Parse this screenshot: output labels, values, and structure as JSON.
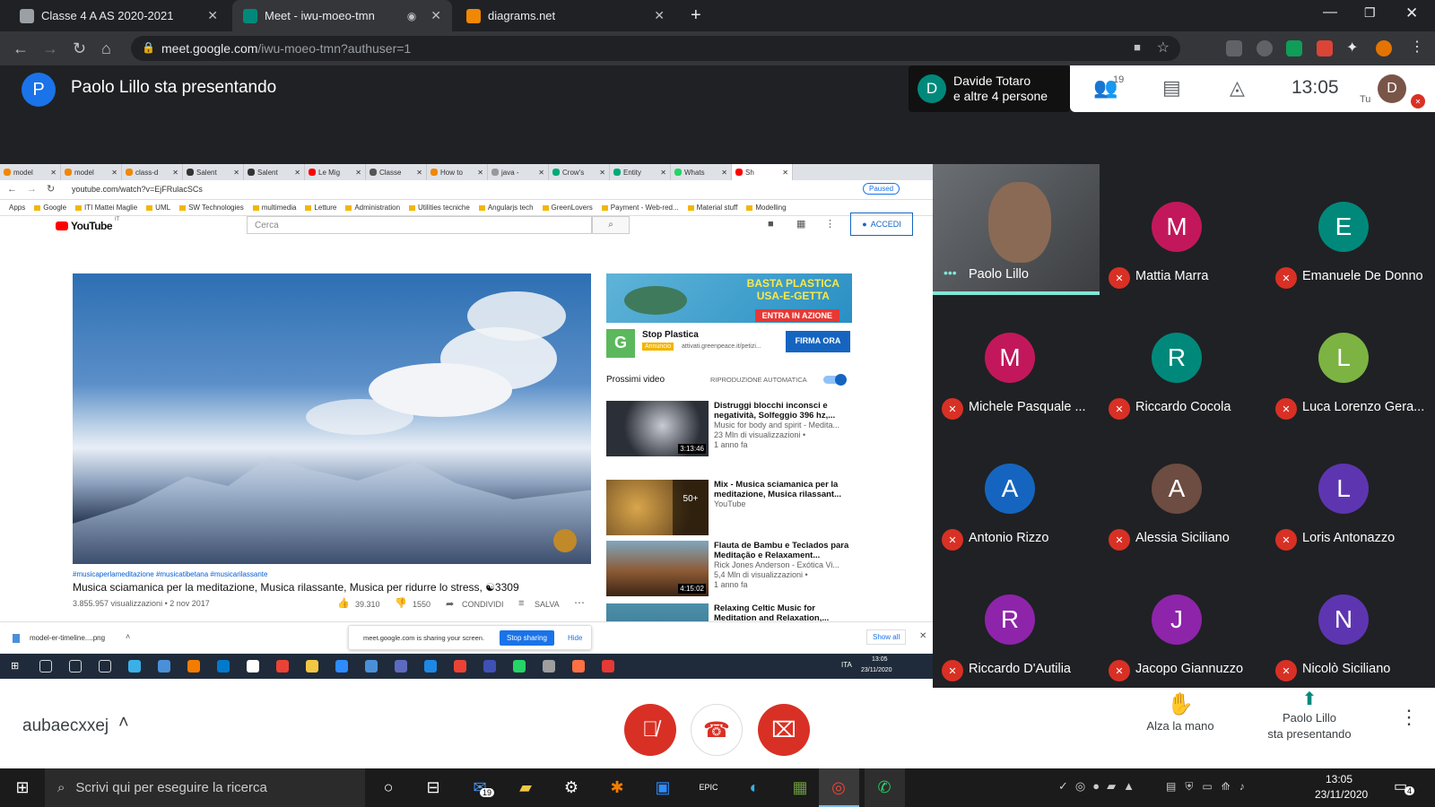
{
  "browser": {
    "tabs": [
      {
        "title": "Classe 4 A AS 2020-2021",
        "icon": "classroom-icon",
        "color": "#e8eaed"
      },
      {
        "title": "Meet - iwu-moeo-tmn",
        "icon": "meet-icon",
        "color": "#00897b",
        "active": true
      },
      {
        "title": "diagrams.net",
        "icon": "drawio-icon",
        "color": "#f08705"
      }
    ],
    "url_host": "meet.google.com",
    "url_path": "/iwu-moeo-tmn?authuser=1"
  },
  "meet": {
    "presenter_initial": "P",
    "presenter_title": "Paolo Lillo sta presentando",
    "pinned_initial": "D",
    "pinned_line1": "Davide Totaro",
    "pinned_line2": "e altre 4 persone",
    "participants_count": "19",
    "time": "13:05",
    "self_label": "Tu",
    "self_initial": "D",
    "meeting_code": "aubaecxxej",
    "raise_hand": "Alza la mano",
    "presenting_line1": "Paolo Lillo",
    "presenting_line2": "sta presentando"
  },
  "participants": [
    {
      "name": "Paolo Lillo",
      "initial": "",
      "color": "#444",
      "video": true
    },
    {
      "name": "Mattia Marra",
      "initial": "M",
      "color": "#c2185b"
    },
    {
      "name": "Emanuele De Donno",
      "initial": "E",
      "color": "#00897b"
    },
    {
      "name": "Michele Pasquale ...",
      "initial": "M",
      "color": "#c2185b"
    },
    {
      "name": "Riccardo Cocola",
      "initial": "R",
      "color": "#00897b"
    },
    {
      "name": "Luca Lorenzo Gera...",
      "initial": "L",
      "color": "#7cb342"
    },
    {
      "name": "Antonio Rizzo",
      "initial": "A",
      "color": "#1565c0"
    },
    {
      "name": "Alessia Siciliano",
      "initial": "A",
      "color": "#6d4c41"
    },
    {
      "name": "Loris Antonazzo",
      "initial": "L",
      "color": "#5e35b1"
    },
    {
      "name": "Riccardo D'Autilia",
      "initial": "R",
      "color": "#8e24aa"
    },
    {
      "name": "Jacopo Giannuzzo",
      "initial": "J",
      "color": "#8e24aa"
    },
    {
      "name": "Nicolò Siciliano",
      "initial": "N",
      "color": "#5e35b1"
    }
  ],
  "shared": {
    "inner_tabs": [
      "model",
      "model",
      "class-d",
      "Salent",
      "Salent",
      "Le Mig",
      "Classe",
      "How to",
      "java -",
      "Crow's",
      "Entity",
      "Whats",
      "Sh"
    ],
    "inner_url": "youtube.com/watch?v=EjFRulacSCs",
    "paused": "Paused",
    "apps": "Apps",
    "bookmarks": [
      "Google",
      "ITI Mattei Maglie",
      "UML",
      "SW Technologies",
      "multimedia",
      "Letture",
      "Administration",
      "Utilities tecniche",
      "Angularjs tech",
      "GreenLovers",
      "Payment - Web-red...",
      "Material stuff",
      "Modelling"
    ],
    "yt_logo": "YouTube",
    "yt_country": "IT",
    "search_placeholder": "Cerca",
    "signin": "ACCEDI",
    "hashtags": "#musicaperlameditazione #musicatibetana #musicarilassante",
    "video_title": "Musica sciamanica per la meditazione, Musica rilassante, Musica per ridurre lo stress, ☯3309",
    "views": "3.855.957 visualizzazioni • 2 nov 2017",
    "likes": "39.310",
    "dislikes": "1550",
    "share": "CONDIVIDI",
    "save": "SALVA",
    "ad_banner_line1": "BASTA PLASTICA",
    "ad_banner_line2": "USA-E-GETTA",
    "ad_banner_cta": "ENTRA IN AZIONE",
    "ad_title": "Stop Plastica",
    "ad_badge": "Annuncio",
    "ad_url": "attivati.greenpeace.it/petizi...",
    "ad_button": "FIRMA ORA",
    "up_next": "Prossimi video",
    "autoplay": "RIPRODUZIONE AUTOMATICA",
    "videos": [
      {
        "title": "Distruggi blocchi inconsci e negatività, Solfeggio 396 hz,...",
        "channel": "Music for body and spirit - Medita...",
        "views": "23 Mln di visualizzazioni •",
        "age": "1 anno fa",
        "duration": "3:13:46",
        "thumb": "#2b2f38"
      },
      {
        "title": "Mix - Musica sciamanica per la meditazione, Musica rilassant...",
        "channel": "YouTube",
        "views": "",
        "age": "",
        "duration": "50+",
        "thumb": "#6b4a22"
      },
      {
        "title": "Flauta de Bambu e Teclados para Meditação e Relaxament...",
        "channel": "Rick Jones Anderson - Exótica Vi...",
        "views": "5,4 Mln di visualizzazioni •",
        "age": "1 anno fa",
        "duration": "4:15:02",
        "thumb": "#8c5a34"
      },
      {
        "title": "Relaxing Celtic Music for Meditation and Relaxation,...",
        "channel": "",
        "views": "",
        "age": "",
        "duration": "",
        "thumb": "#2d6e8a"
      }
    ],
    "download_file": "model-er-timeline....png",
    "sharing_text": "meet.google.com is sharing your screen.",
    "stop_sharing": "Stop sharing",
    "hide": "Hide",
    "show_all": "Show all",
    "taskbar_time": "13:05",
    "taskbar_date": "23/11/2020",
    "taskbar_lang": "ITA"
  },
  "windows": {
    "search": "Scrivi qui per eseguire la ricerca",
    "time": "13:05",
    "date": "23/11/2020",
    "mail_badge": "19",
    "notif_count": "4"
  }
}
